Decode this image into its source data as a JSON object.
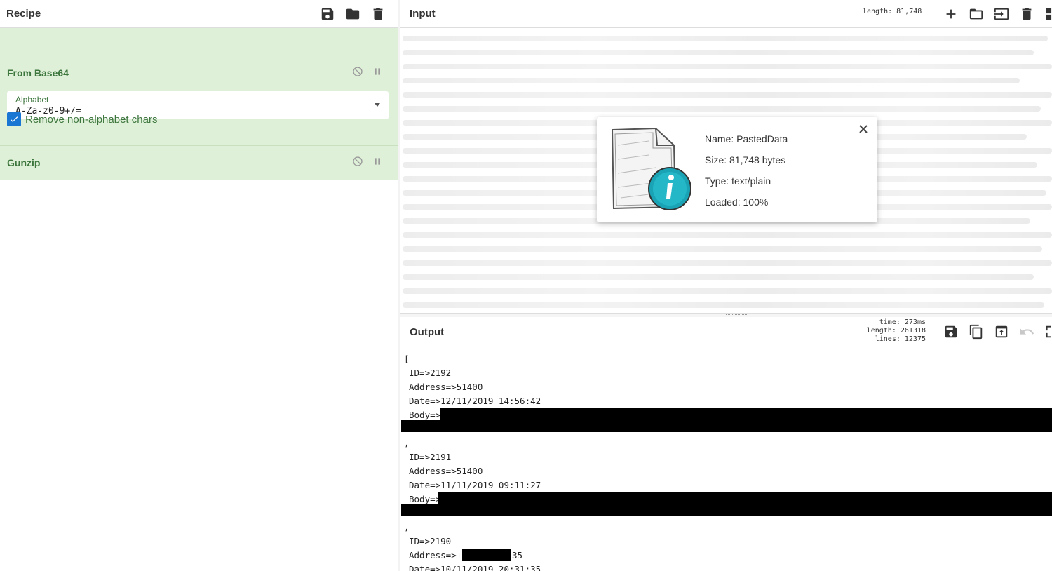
{
  "recipe": {
    "title": "Recipe",
    "operations": [
      {
        "name": "From Base64",
        "alphabet_label": "Alphabet",
        "alphabet_value": "A-Za-z0-9+/=",
        "remove_nonalpha_label": "Remove non-alphabet chars",
        "remove_nonalpha_checked": true
      },
      {
        "name": "Gunzip"
      }
    ]
  },
  "input": {
    "title": "Input",
    "length": "length: 81,748"
  },
  "file_info": {
    "name": "Name: PastedData",
    "size": "Size: 81,748 bytes",
    "type": "Type: text/plain",
    "loaded": "Loaded: 100%"
  },
  "output": {
    "title": "Output",
    "time": "time:  273ms",
    "length": "length: 261318",
    "lines": "lines:  12375",
    "open_bracket": "[",
    "separator": ",",
    "records": [
      {
        "id": "ID=>2192",
        "address": "Address=>51400",
        "date": "Date=>12/11/2019 14:56:42",
        "body": "Body=>"
      },
      {
        "id": "ID=>2191",
        "address": "Address=>51400",
        "date": "Date=>11/11/2019 09:11:27",
        "body": "Body=>"
      },
      {
        "id": "ID=>2190",
        "address_prefix": "Address=>+",
        "address_suffix": "35",
        "date": "Date=>10/11/2019 20:31:35"
      }
    ]
  },
  "colors": {
    "recipe_op_bg": "#dff0d8",
    "recipe_op_text": "#3c763d",
    "checkbox": "#1976d2",
    "info_icon": "#1aa3b5",
    "redaction": "#000000"
  }
}
